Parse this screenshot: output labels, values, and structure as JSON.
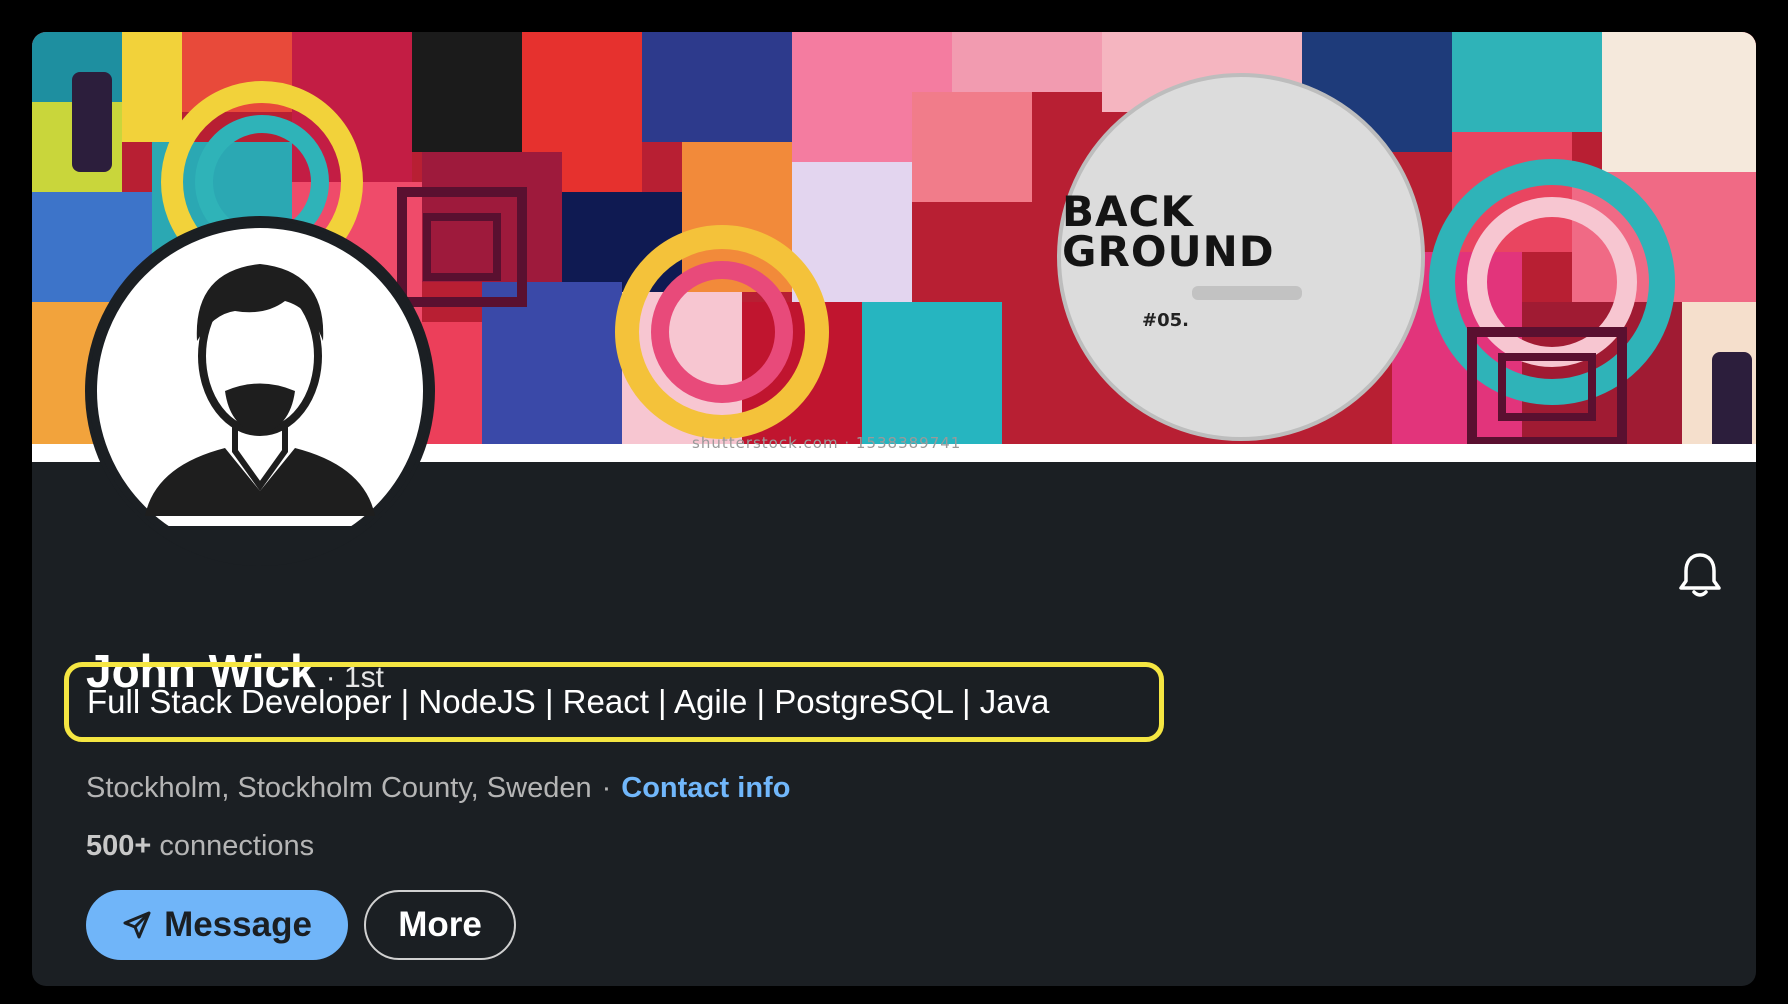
{
  "banner": {
    "badge_title_line1": "BACK",
    "badge_title_line2": "GROUND",
    "badge_number": "#05.",
    "watermark": "shutterstock.com · 1538389741"
  },
  "profile": {
    "name": "John Wick",
    "degree": "· 1st",
    "headline": "Full Stack Developer | NodeJS | React | Agile | PostgreSQL | Java",
    "location": "Stockholm, Stockholm County, Sweden",
    "separator": "·",
    "contact_info_label": "Contact info",
    "connections_count": "500+",
    "connections_label": "connections"
  },
  "actions": {
    "message_label": "Message",
    "more_label": "More"
  },
  "icons": {
    "bell": "bell-icon",
    "send": "send-icon",
    "avatar": "default-person-avatar"
  },
  "colors": {
    "background": "#000000",
    "card": "#1b1f23",
    "accent_blue": "#70b5f9",
    "highlight_yellow": "#f5e642",
    "text_secondary": "#b5b5b5"
  }
}
